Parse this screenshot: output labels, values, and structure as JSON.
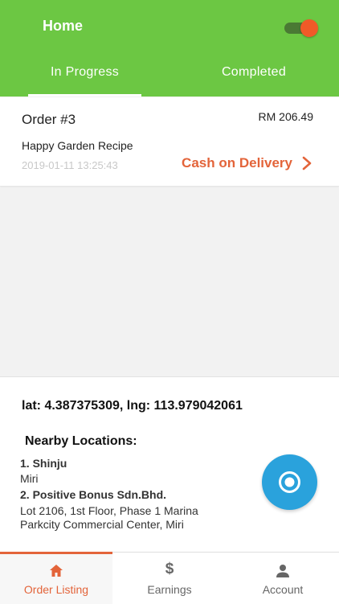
{
  "header": {
    "title": "Home",
    "toggle_on": true,
    "tabs": [
      {
        "label": "In Progress",
        "active": true
      },
      {
        "label": "Completed",
        "active": false
      }
    ]
  },
  "order": {
    "number": "Order #3",
    "amount": "RM 206.49",
    "restaurant": "Happy Garden Recipe",
    "timestamp": "2019-01-11 13:25:43",
    "payment_method": "Cash on Delivery"
  },
  "location": {
    "coordinates": "lat: 4.387375309, lng: 113.979042061",
    "nearby_title": "Nearby Locations:",
    "places": [
      {
        "name": "1. Shinju",
        "address": "Miri"
      },
      {
        "name": "2. Positive Bonus Sdn.Bhd.",
        "address": "Lot 2106, 1st Floor, Phase 1 Marina Parkcity Commercial Center, Miri"
      }
    ]
  },
  "bottom_nav": {
    "items": [
      {
        "label": "Order Listing",
        "icon": "home-icon",
        "active": true
      },
      {
        "label": "Earnings",
        "icon": "dollar-icon",
        "active": false
      },
      {
        "label": "Account",
        "icon": "person-icon",
        "active": false
      }
    ]
  },
  "colors": {
    "header_green": "#6cc743",
    "accent_orange": "#e3643a",
    "fab_blue": "#2aa2dc"
  }
}
